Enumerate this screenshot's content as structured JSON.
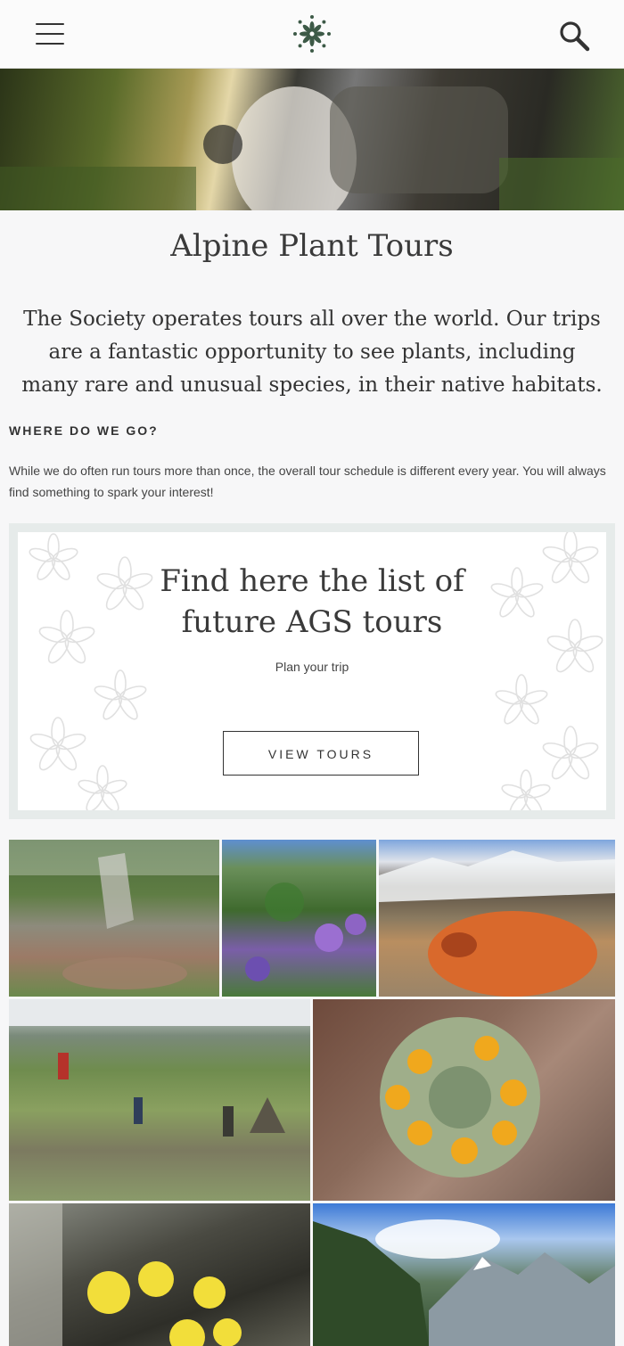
{
  "header": {
    "menu_icon": "hamburger-menu-icon",
    "logo_icon": "flower-logo-icon",
    "search_icon": "search-icon"
  },
  "page": {
    "title": "Alpine Plant Tours",
    "intro": "The Society operates tours all over the world. Our trips are a fantastic opportunity to see plants, including many rare and unusual species, in their native habitats."
  },
  "section": {
    "heading": "WHERE DO WE GO?",
    "text": "While we do often run tours more than once, the overall tour schedule is different every year. You will always find something to spark your interest!"
  },
  "promo": {
    "title_line1": "Find here the list of",
    "title_line2": "future AGS tours",
    "subtitle": "Plan your trip",
    "button_label": "VIEW TOURS"
  },
  "colors": {
    "brand_green": "#3d5a47",
    "promo_frame": "#e6ebea",
    "text": "#333333"
  }
}
